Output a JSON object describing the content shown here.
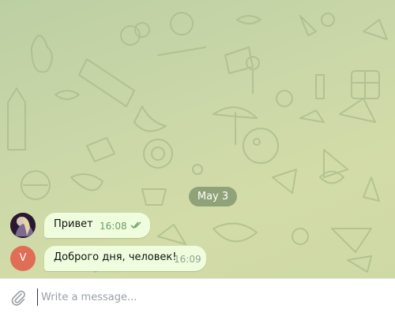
{
  "chat": {
    "date_separator": "May 3",
    "messages": [
      {
        "text": "Привет",
        "time": "16:08",
        "read": true,
        "avatar": "photo"
      },
      {
        "text": "Доброго дня, человек!",
        "time": "16:09",
        "read": false,
        "avatar_letter": "V"
      }
    ]
  },
  "composer": {
    "placeholder": "Write a message...",
    "value": ""
  },
  "colors": {
    "bubble": "#effdde",
    "time_read": "#6aa063",
    "avatar_letter_bg": "#e06d55",
    "date_pill_bg": "#768c65"
  }
}
